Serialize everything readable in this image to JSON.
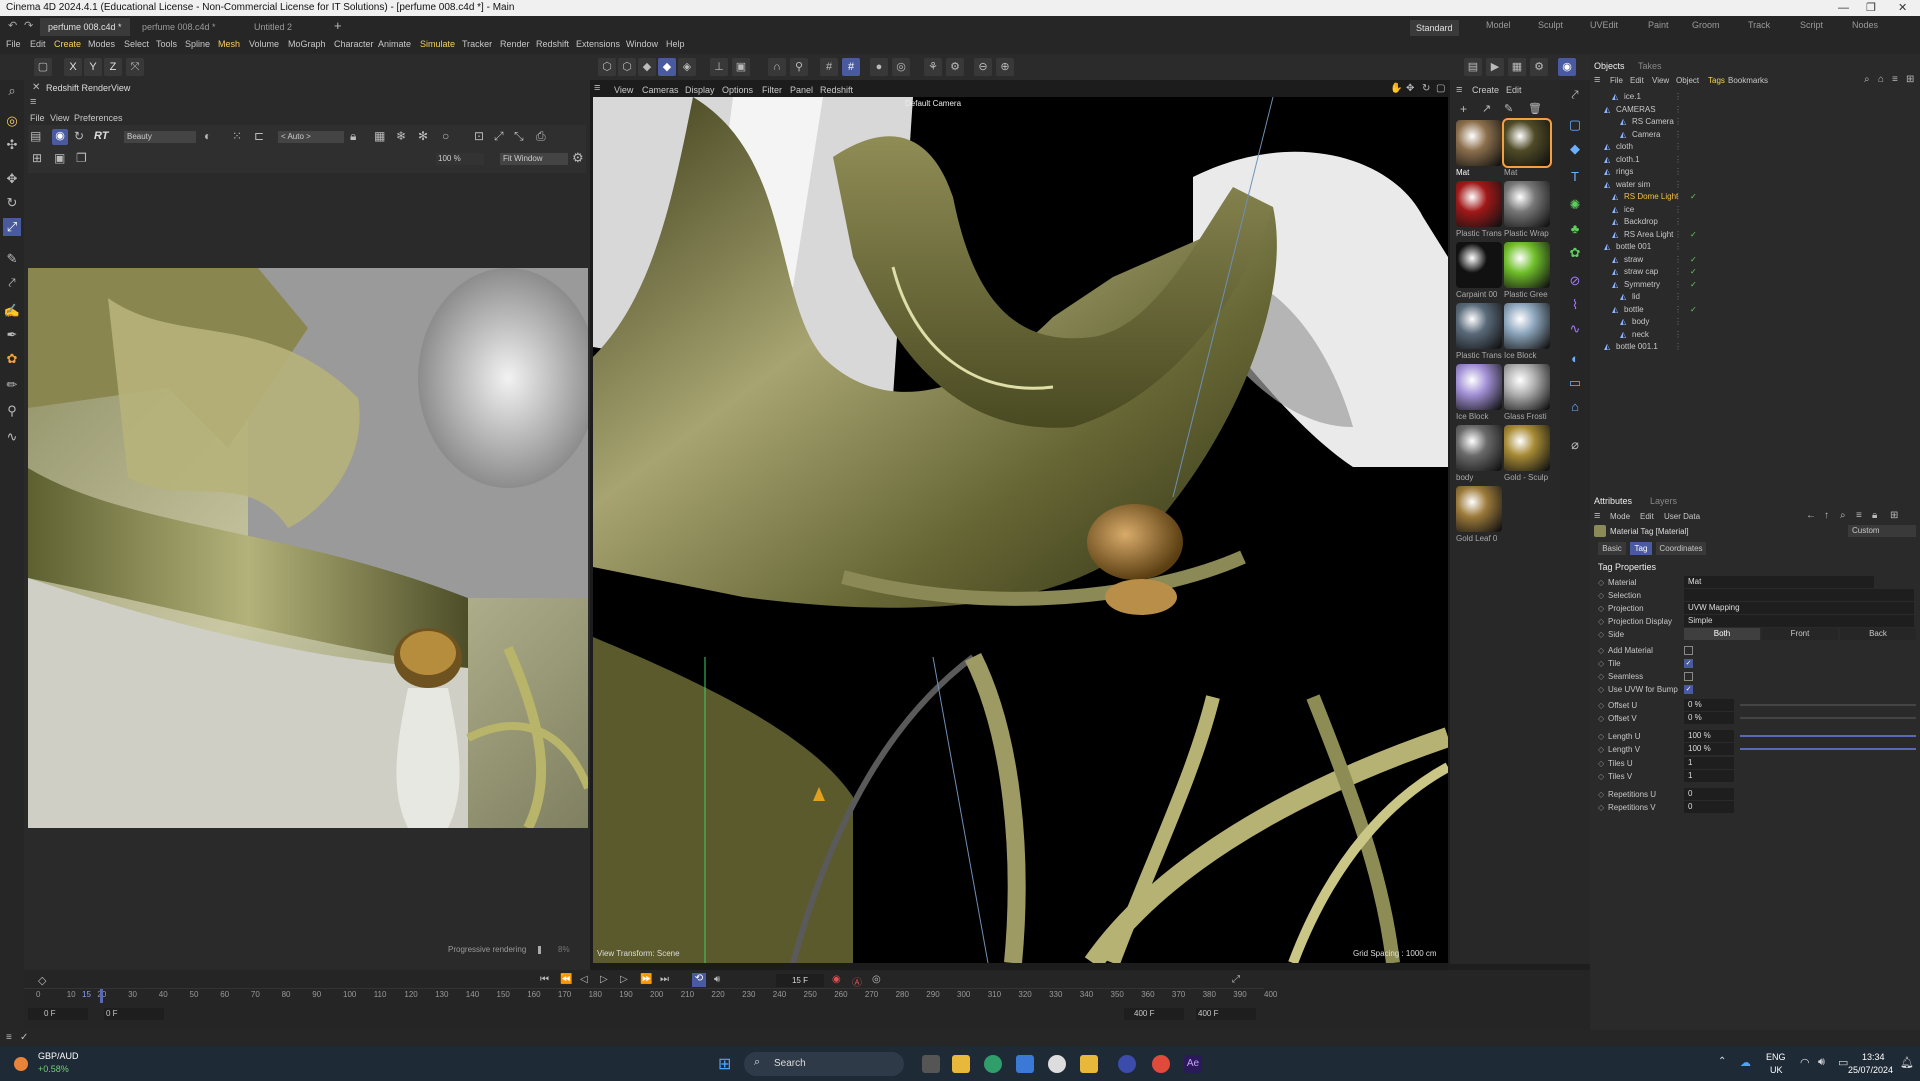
{
  "window": {
    "title": "Cinema 4D 2024.4.1 (Educational License - Non-Commercial License for IT Solutions) - [perfume 008.c4d *] - Main"
  },
  "doc_tabs": [
    "perfume 008.c4d *",
    "perfume 008.c4d *",
    "Untitled 2"
  ],
  "layouts": [
    "Standard",
    "Model",
    "Sculpt",
    "UVEdit",
    "Paint",
    "Groom",
    "Track",
    "Script",
    "Nodes"
  ],
  "menus": [
    "File",
    "Edit",
    "Create",
    "Modes",
    "Select",
    "Tools",
    "Spline",
    "Mesh",
    "Volume",
    "MoGraph",
    "Character",
    "Animate",
    "Simulate",
    "Tracker",
    "Render",
    "Redshift",
    "Extensions",
    "Window",
    "Help"
  ],
  "renderview": {
    "title": "Redshift RenderView",
    "menu": [
      "File",
      "View",
      "Preferences"
    ],
    "aov": "Beauty",
    "rt_label": "RT",
    "auto": "< Auto >",
    "zoom": "100 %",
    "fit": "Fit Window",
    "progress_label": "Progressive rendering",
    "progress_pct": "8%"
  },
  "viewport": {
    "menu": [
      "View",
      "Cameras",
      "Display",
      "Options",
      "Filter",
      "Panel",
      "Redshift"
    ],
    "camera": "Default Camera",
    "transform": "View Transform: Scene",
    "grid": "Grid Spacing : 1000 cm"
  },
  "materials": {
    "menu": [
      "Create",
      "Edit"
    ],
    "items": [
      "Mat",
      "Mat",
      "Plastic Trans",
      "Plastic Wrap",
      "Carpaint 00",
      "Plastic Gree",
      "Plastic Trans",
      "Ice Block",
      "Ice Block",
      "Glass Frosti",
      "body",
      "Gold - Sculp",
      "Gold Leaf 0"
    ]
  },
  "objects": {
    "tabs": [
      "Objects",
      "Takes"
    ],
    "menu": [
      "File",
      "Edit",
      "View",
      "Object",
      "Tags",
      "Bookmarks"
    ],
    "rows": [
      {
        "name": "ice.1",
        "check": ""
      },
      {
        "name": "CAMERAS",
        "check": ""
      },
      {
        "name": "RS Camera",
        "check": ""
      },
      {
        "name": "Camera",
        "check": ""
      },
      {
        "name": "cloth",
        "check": ""
      },
      {
        "name": "cloth.1",
        "check": ""
      },
      {
        "name": "rings",
        "check": ""
      },
      {
        "name": "water sim",
        "check": ""
      },
      {
        "name": "RS Dome Light",
        "check": "✓"
      },
      {
        "name": "ice",
        "check": ""
      },
      {
        "name": "Backdrop",
        "check": ""
      },
      {
        "name": "RS Area Light",
        "check": "✓"
      },
      {
        "name": "bottle 001",
        "check": ""
      },
      {
        "name": "straw",
        "check": "✓"
      },
      {
        "name": "straw cap",
        "check": "✓"
      },
      {
        "name": "Symmetry",
        "check": "✓"
      },
      {
        "name": "lid",
        "check": ""
      },
      {
        "name": "bottle",
        "check": "✓"
      },
      {
        "name": "body",
        "check": ""
      },
      {
        "name": "neck",
        "check": ""
      },
      {
        "name": "bottle 001.1",
        "check": ""
      }
    ]
  },
  "attributes": {
    "tabs": [
      "Attributes",
      "Layers"
    ],
    "menu": [
      "Mode",
      "Edit",
      "User Data"
    ],
    "header": "Material Tag [Material]",
    "preset": "Custom",
    "subtabs": [
      "Basic",
      "Tag",
      "Coordinates"
    ],
    "section": "Tag Properties",
    "material": {
      "label": "Material",
      "value": "Mat"
    },
    "selection": {
      "label": "Selection",
      "value": ""
    },
    "projection": {
      "label": "Projection",
      "value": "UVW Mapping"
    },
    "projection_display": {
      "label": "Projection Display",
      "value": "Simple"
    },
    "side": {
      "label": "Side",
      "options": [
        "Both",
        "Front",
        "Back"
      ]
    },
    "add_material": "Add Material",
    "tile": "Tile",
    "seamless": "Seamless",
    "use_uvw": "Use UVW for Bump",
    "offset_u": {
      "label": "Offset U",
      "value": "0 %"
    },
    "offset_v": {
      "label": "Offset V",
      "value": "0 %"
    },
    "length_u": {
      "label": "Length U",
      "value": "100 %"
    },
    "length_v": {
      "label": "Length V",
      "value": "100 %"
    },
    "tiles_u": {
      "label": "Tiles U",
      "value": "1"
    },
    "tiles_v": {
      "label": "Tiles V",
      "value": "1"
    },
    "rep_u": {
      "label": "Repetitions U",
      "value": "0"
    },
    "rep_v": {
      "label": "Repetitions V",
      "value": "0"
    }
  },
  "timeline": {
    "frame": "15 F",
    "ticks": [
      "0",
      "10",
      "15",
      "20",
      "30",
      "40",
      "50",
      "60",
      "70",
      "80",
      "90",
      "100",
      "110",
      "120",
      "130",
      "140",
      "150",
      "160",
      "170",
      "180",
      "190",
      "200",
      "210",
      "220",
      "230",
      "240",
      "250",
      "260",
      "270",
      "280",
      "290",
      "300",
      "310",
      "320",
      "330",
      "340",
      "350",
      "360",
      "370",
      "380",
      "390",
      "400"
    ],
    "start": "0 F",
    "start2": "0 F",
    "end": "400 F",
    "end2": "400 F"
  },
  "taskbar": {
    "ticker": "GBP/AUD",
    "change": "+0.58%",
    "search": "Search",
    "lang": "ENG",
    "region": "UK",
    "time": "13:34",
    "date": "25/07/2024"
  }
}
